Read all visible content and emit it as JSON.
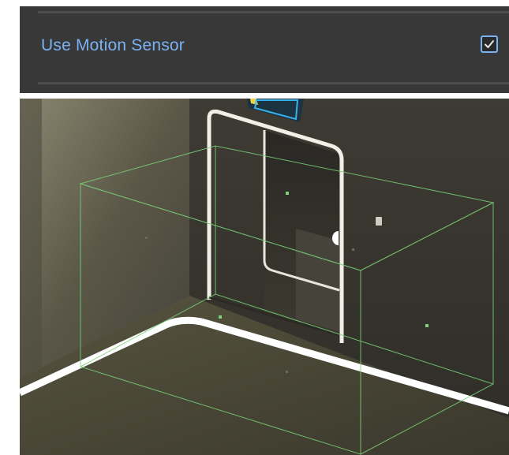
{
  "inspector": {
    "property_label": "Use Motion Sensor",
    "property_checked": true,
    "label_color": "#7ab2f4",
    "panel_color": "#383838"
  },
  "scene": {
    "wall_color": "#3a3830",
    "floor_color": "#4a4738",
    "gizmo_color": "#7ad27a",
    "trim_color": "#f2f0e6",
    "sign_color": "#3ab0e8"
  }
}
